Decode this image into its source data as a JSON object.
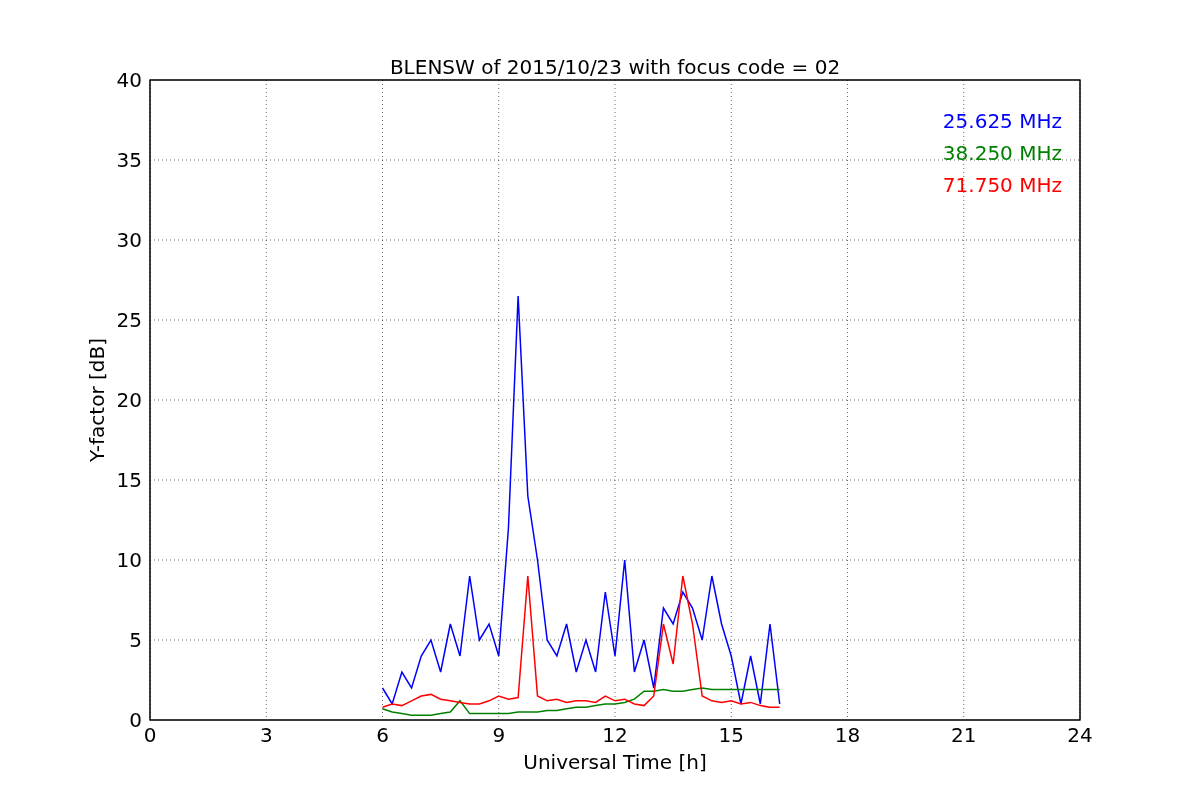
{
  "chart_data": {
    "type": "line",
    "title": "BLENSW of 2015/10/23 with focus code = 02",
    "xlabel": "Universal Time [h]",
    "ylabel": "Y-factor [dB]",
    "xlim": [
      0,
      24
    ],
    "ylim": [
      0,
      40
    ],
    "xticks": [
      0,
      3,
      6,
      9,
      12,
      15,
      18,
      21,
      24
    ],
    "yticks": [
      0,
      5,
      10,
      15,
      20,
      25,
      30,
      35,
      40
    ],
    "grid": true,
    "x": [
      6,
      6.25,
      6.5,
      6.75,
      7,
      7.25,
      7.5,
      7.75,
      8,
      8.25,
      8.5,
      8.75,
      9,
      9.25,
      9.5,
      9.75,
      10,
      10.25,
      10.5,
      10.75,
      11,
      11.25,
      11.5,
      11.75,
      12,
      12.25,
      12.5,
      12.75,
      13,
      13.25,
      13.5,
      13.75,
      14,
      14.25,
      14.5,
      14.75,
      15,
      15.25,
      15.5,
      15.75,
      16,
      16.25
    ],
    "series": [
      {
        "name": "25.625 MHz",
        "color": "#0000ff",
        "values": [
          2,
          1,
          3,
          2,
          4,
          5,
          3,
          6,
          4,
          9,
          5,
          6,
          4,
          12,
          26.5,
          14,
          10,
          5,
          4,
          6,
          3,
          5,
          3,
          8,
          4,
          10,
          3,
          5,
          2,
          7,
          6,
          8,
          7,
          5,
          9,
          6,
          4,
          1,
          4,
          1,
          6,
          1
        ]
      },
      {
        "name": "38.250 MHz",
        "color": "#008000",
        "values": [
          0.7,
          0.5,
          0.4,
          0.3,
          0.3,
          0.3,
          0.4,
          0.5,
          1.2,
          0.4,
          0.4,
          0.4,
          0.4,
          0.4,
          0.5,
          0.5,
          0.5,
          0.6,
          0.6,
          0.7,
          0.8,
          0.8,
          0.9,
          1.0,
          1.0,
          1.1,
          1.3,
          1.8,
          1.8,
          1.9,
          1.8,
          1.8,
          1.9,
          2.0,
          1.9,
          1.9,
          1.9,
          1.9,
          1.9,
          1.9,
          1.9,
          1.9
        ]
      },
      {
        "name": "71.750 MHz",
        "color": "#ff0000",
        "values": [
          0.8,
          1.0,
          0.9,
          1.2,
          1.5,
          1.6,
          1.3,
          1.2,
          1.1,
          1.0,
          1.0,
          1.2,
          1.5,
          1.3,
          1.4,
          9.0,
          1.5,
          1.2,
          1.3,
          1.1,
          1.2,
          1.2,
          1.1,
          1.5,
          1.2,
          1.3,
          1.0,
          0.9,
          1.5,
          6.0,
          3.5,
          9.0,
          6.0,
          1.5,
          1.2,
          1.1,
          1.2,
          1.0,
          1.1,
          0.9,
          0.8,
          0.8
        ]
      }
    ]
  }
}
